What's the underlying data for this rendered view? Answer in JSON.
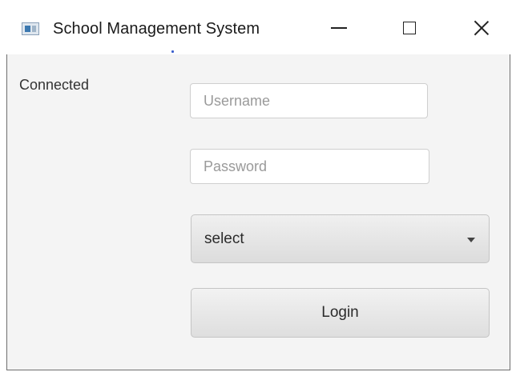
{
  "window": {
    "title": "School Management System",
    "controls": {
      "minimize": "minimize-icon",
      "maximize": "maximize-icon",
      "close": "close-icon"
    }
  },
  "status": {
    "text": "Connected"
  },
  "form": {
    "username": {
      "value": "",
      "placeholder": "Username"
    },
    "password": {
      "value": "",
      "placeholder": "Password"
    },
    "role_select": {
      "selected": "select"
    },
    "login_label": "Login"
  },
  "colors": {
    "window_background": "#f4f4f4",
    "titlebar_background": "#ffffff",
    "button_gradient_top": "#f2f2f2",
    "button_gradient_bottom": "#dedede"
  }
}
